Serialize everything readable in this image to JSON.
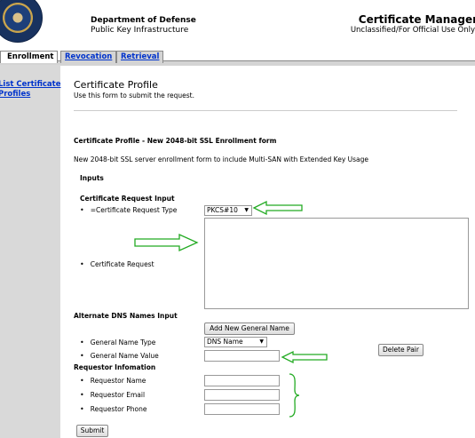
{
  "header": {
    "department": "Department of Defense",
    "subtitle": "Public Key Infrastructure",
    "app_title": "Certificate Manager",
    "classification": "Unclassified/For Official Use Only"
  },
  "tabs": [
    {
      "label": "Enrollment",
      "active": true
    },
    {
      "label": "Revocation",
      "active": false
    },
    {
      "label": "Retrieval",
      "active": false
    }
  ],
  "sidebar": {
    "link_line1": "List Certificate",
    "link_line2": "Profiles"
  },
  "section": {
    "title": "Certificate Profile",
    "subtitle": "Use this form to submit the request."
  },
  "profile": {
    "heading": "Certificate Profile - New 2048-bit SSL Enrollment form",
    "description": "New 2048-bit SSL server enrollment form to include Multi-SAN with Extended Key Usage",
    "inputs_heading": "Inputs"
  },
  "request_input": {
    "heading": "Certificate Request Input",
    "type_label": "=Certificate Request Type",
    "type_value": "PKCS#10",
    "request_label": "Certificate Request"
  },
  "alt_dns": {
    "heading": "Alternate DNS Names Input",
    "add_button": "Add New General Name",
    "name_type_label": "General Name Type",
    "name_type_value": "DNS Name",
    "name_value_label": "General Name Value",
    "delete_button": "Delete Pair"
  },
  "requestor": {
    "heading": "Requestor Infomation",
    "name_label": "Requestor Name",
    "email_label": "Requestor Email",
    "phone_label": "Requestor Phone"
  },
  "submit_label": "Submit",
  "colors": {
    "link": "#0033cc",
    "annotation": "#22aa22",
    "sidebar": "#d9d9d9"
  }
}
